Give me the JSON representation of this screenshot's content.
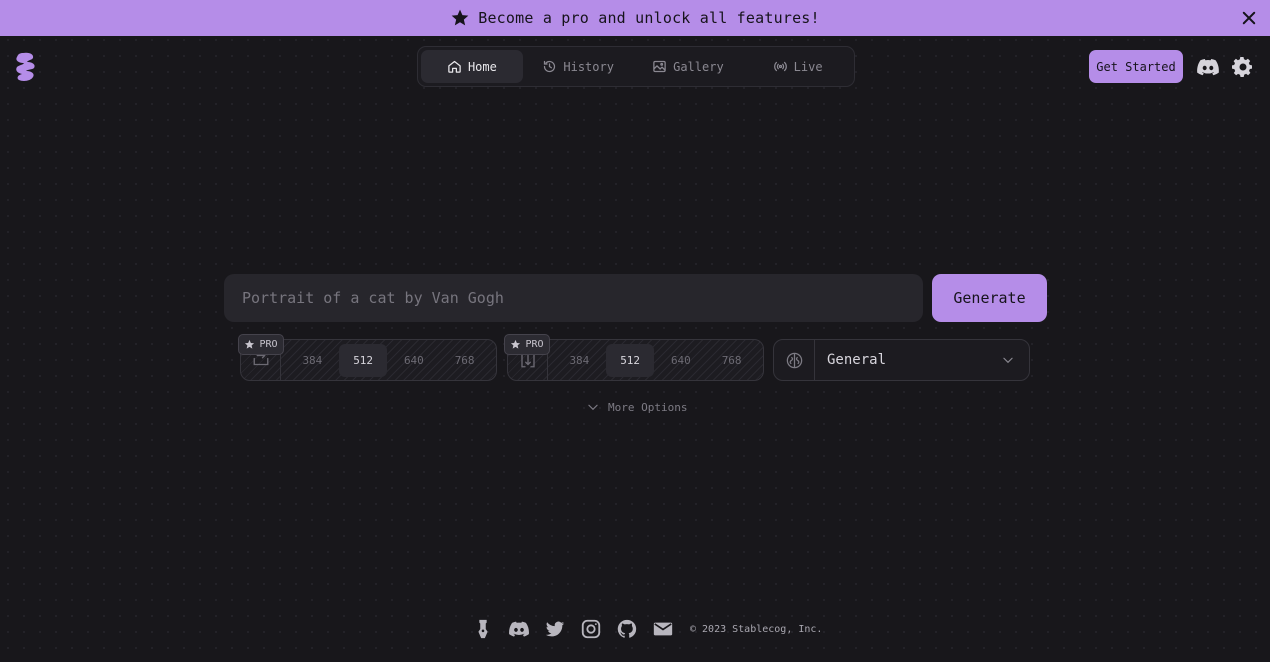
{
  "banner": {
    "text": "Become a pro and unlock all features!"
  },
  "nav": {
    "tabs": [
      {
        "label": "Home",
        "icon": "home-icon",
        "active": true
      },
      {
        "label": "History",
        "icon": "history-icon"
      },
      {
        "label": "Gallery",
        "icon": "gallery-icon"
      },
      {
        "label": "Live",
        "icon": "live-icon"
      }
    ]
  },
  "header": {
    "get_started": "Get Started"
  },
  "prompt": {
    "placeholder": "Portrait of a cat by Van Gogh",
    "generate_label": "Generate"
  },
  "width_sizes": {
    "badge": "PRO",
    "options": [
      "384",
      "512",
      "640",
      "768"
    ],
    "selected": "512"
  },
  "height_sizes": {
    "badge": "PRO",
    "options": [
      "384",
      "512",
      "640",
      "768"
    ],
    "selected": "512"
  },
  "model": {
    "selected": "General"
  },
  "more_options": {
    "label": "More Options"
  },
  "footer": {
    "copyright": "© 2023 Stablecog, Inc."
  },
  "colors": {
    "accent": "#b58de8",
    "background": "#18171b",
    "surface": "#27262c"
  }
}
